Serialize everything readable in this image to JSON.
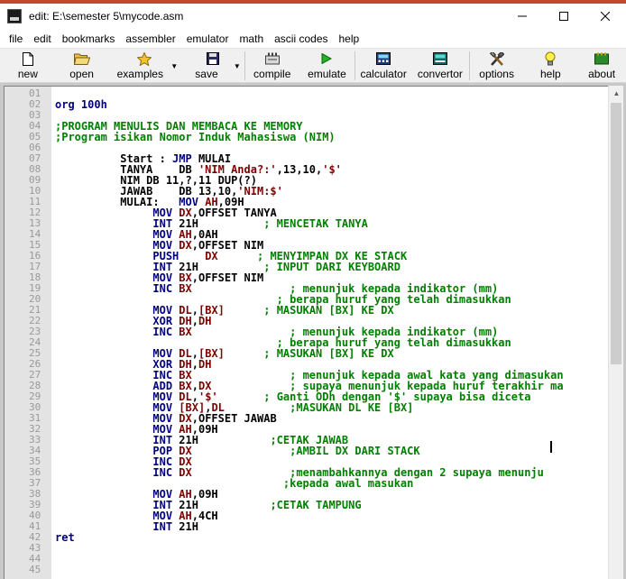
{
  "window": {
    "title": "edit: E:\\semester 5\\mycode.asm",
    "controls": [
      "minimize-icon",
      "maximize-icon",
      "close-icon"
    ]
  },
  "menu": [
    "file",
    "edit",
    "bookmarks",
    "assembler",
    "emulator",
    "math",
    "ascii codes",
    "help"
  ],
  "toolbar": [
    {
      "name": "new",
      "label": "new",
      "icon": "document-icon"
    },
    {
      "name": "open",
      "label": "open",
      "icon": "folder-icon"
    },
    {
      "name": "examples",
      "label": "examples",
      "icon": "star-icon"
    },
    {
      "name": "save",
      "label": "save",
      "icon": "floppy-icon"
    },
    {
      "name": "compile",
      "label": "compile",
      "icon": "compile-icon"
    },
    {
      "name": "emulate",
      "label": "emulate",
      "icon": "play-icon"
    },
    {
      "name": "calculator",
      "label": "calculator",
      "icon": "calculator-icon"
    },
    {
      "name": "convertor",
      "label": "convertor",
      "icon": "convertor-icon"
    },
    {
      "name": "options",
      "label": "options",
      "icon": "tools-icon"
    },
    {
      "name": "help",
      "label": "help",
      "icon": "lightbulb-icon"
    },
    {
      "name": "about",
      "label": "about",
      "icon": "about-icon"
    }
  ],
  "colors": {
    "directive": "#000080",
    "comment": "#008000",
    "register": "#800000",
    "gutter": "#e3e3e3"
  },
  "code": {
    "line_numbers": [
      "01",
      "02",
      "03",
      "04",
      "05",
      "06",
      "07",
      "08",
      "09",
      "10",
      "11",
      "12",
      "13",
      "14",
      "15",
      "16",
      "17",
      "18",
      "19",
      "20",
      "21",
      "22",
      "23",
      "24",
      "25",
      "26",
      "27",
      "28",
      "29",
      "30",
      "31",
      "32",
      "33",
      "34",
      "35",
      "36",
      "37",
      "38",
      "39",
      "40",
      "41",
      "42",
      "43",
      "44",
      "45"
    ],
    "lines": [
      [],
      [
        {
          "t": "org 100h",
          "c": "c-dir"
        }
      ],
      [],
      [
        {
          "t": ";PROGRAM MENULIS DAN MEMBACA KE MEMORY",
          "c": "c-cmt"
        }
      ],
      [
        {
          "t": ";Program isikan Nomor Induk Mahasiswa (NIM)",
          "c": "c-cmt"
        }
      ],
      [],
      [
        {
          "t": "          Start : ",
          "c": "c-txt"
        },
        {
          "t": "JMP",
          "c": "c-kw"
        },
        {
          "t": " MULAI",
          "c": "c-txt"
        }
      ],
      [
        {
          "t": "          TANYA    DB ",
          "c": "c-txt"
        },
        {
          "t": "'NIM Anda?:'",
          "c": "c-str"
        },
        {
          "t": ",13,10,",
          "c": "c-txt"
        },
        {
          "t": "'$'",
          "c": "c-str"
        }
      ],
      [
        {
          "t": "          NIM DB 11,?,11 DUP(?)",
          "c": "c-txt"
        }
      ],
      [
        {
          "t": "          JAWAB    DB 13,10,",
          "c": "c-txt"
        },
        {
          "t": "'NIM:$'",
          "c": "c-str"
        }
      ],
      [
        {
          "t": "          MULAI:   ",
          "c": "c-txt"
        },
        {
          "t": "MOV",
          "c": "c-kw"
        },
        {
          "t": " ",
          "c": "c-txt"
        },
        {
          "t": "AH",
          "c": "c-reg"
        },
        {
          "t": ",09H",
          "c": "c-txt"
        }
      ],
      [
        {
          "t": "               ",
          "c": "c-txt"
        },
        {
          "t": "MOV",
          "c": "c-kw"
        },
        {
          "t": " ",
          "c": "c-txt"
        },
        {
          "t": "DX",
          "c": "c-reg"
        },
        {
          "t": ",OFFSET TANYA",
          "c": "c-txt"
        }
      ],
      [
        {
          "t": "               ",
          "c": "c-txt"
        },
        {
          "t": "INT",
          "c": "c-kw"
        },
        {
          "t": " 21H          ",
          "c": "c-txt"
        },
        {
          "t": "; MENCETAK TANYA",
          "c": "c-cmt"
        }
      ],
      [
        {
          "t": "               ",
          "c": "c-txt"
        },
        {
          "t": "MOV",
          "c": "c-kw"
        },
        {
          "t": " ",
          "c": "c-txt"
        },
        {
          "t": "AH",
          "c": "c-reg"
        },
        {
          "t": ",0AH",
          "c": "c-txt"
        }
      ],
      [
        {
          "t": "               ",
          "c": "c-txt"
        },
        {
          "t": "MOV",
          "c": "c-kw"
        },
        {
          "t": " ",
          "c": "c-txt"
        },
        {
          "t": "DX",
          "c": "c-reg"
        },
        {
          "t": ",OFFSET NIM",
          "c": "c-txt"
        }
      ],
      [
        {
          "t": "               ",
          "c": "c-txt"
        },
        {
          "t": "PUSH",
          "c": "c-kw"
        },
        {
          "t": "    ",
          "c": "c-txt"
        },
        {
          "t": "DX",
          "c": "c-reg"
        },
        {
          "t": "      ",
          "c": "c-txt"
        },
        {
          "t": "; MENYIMPAN DX KE STACK",
          "c": "c-cmt"
        }
      ],
      [
        {
          "t": "               ",
          "c": "c-txt"
        },
        {
          "t": "INT",
          "c": "c-kw"
        },
        {
          "t": " 21H          ",
          "c": "c-txt"
        },
        {
          "t": "; INPUT DARI KEYBOARD",
          "c": "c-cmt"
        }
      ],
      [
        {
          "t": "               ",
          "c": "c-txt"
        },
        {
          "t": "MOV",
          "c": "c-kw"
        },
        {
          "t": " ",
          "c": "c-txt"
        },
        {
          "t": "BX",
          "c": "c-reg"
        },
        {
          "t": ",OFFSET NIM",
          "c": "c-txt"
        }
      ],
      [
        {
          "t": "               ",
          "c": "c-txt"
        },
        {
          "t": "INC",
          "c": "c-kw"
        },
        {
          "t": " ",
          "c": "c-txt"
        },
        {
          "t": "BX",
          "c": "c-reg"
        },
        {
          "t": "               ",
          "c": "c-txt"
        },
        {
          "t": "; menunjuk kepada indikator (mm)",
          "c": "c-cmt"
        }
      ],
      [
        {
          "t": "                                  ",
          "c": "c-txt"
        },
        {
          "t": "; berapa huruf yang telah dimasukkan",
          "c": "c-cmt"
        }
      ],
      [
        {
          "t": "               ",
          "c": "c-txt"
        },
        {
          "t": "MOV",
          "c": "c-kw"
        },
        {
          "t": " ",
          "c": "c-txt"
        },
        {
          "t": "DL",
          "c": "c-reg"
        },
        {
          "t": ",",
          "c": "c-txt"
        },
        {
          "t": "[BX]",
          "c": "c-reg"
        },
        {
          "t": "      ",
          "c": "c-txt"
        },
        {
          "t": "; MASUKAN [BX] KE DX",
          "c": "c-cmt"
        }
      ],
      [
        {
          "t": "               ",
          "c": "c-txt"
        },
        {
          "t": "XOR",
          "c": "c-kw"
        },
        {
          "t": " ",
          "c": "c-txt"
        },
        {
          "t": "DH",
          "c": "c-reg"
        },
        {
          "t": ",",
          "c": "c-txt"
        },
        {
          "t": "DH",
          "c": "c-reg"
        }
      ],
      [
        {
          "t": "               ",
          "c": "c-txt"
        },
        {
          "t": "INC",
          "c": "c-kw"
        },
        {
          "t": " ",
          "c": "c-txt"
        },
        {
          "t": "BX",
          "c": "c-reg"
        },
        {
          "t": "               ",
          "c": "c-txt"
        },
        {
          "t": "; menunjuk kepada indikator (mm)",
          "c": "c-cmt"
        }
      ],
      [
        {
          "t": "                                  ",
          "c": "c-txt"
        },
        {
          "t": "; berapa huruf yang telah dimasukkan",
          "c": "c-cmt"
        }
      ],
      [
        {
          "t": "               ",
          "c": "c-txt"
        },
        {
          "t": "MOV",
          "c": "c-kw"
        },
        {
          "t": " ",
          "c": "c-txt"
        },
        {
          "t": "DL",
          "c": "c-reg"
        },
        {
          "t": ",",
          "c": "c-txt"
        },
        {
          "t": "[BX]",
          "c": "c-reg"
        },
        {
          "t": "      ",
          "c": "c-txt"
        },
        {
          "t": "; MASUKAN [BX] KE DX",
          "c": "c-cmt"
        }
      ],
      [
        {
          "t": "               ",
          "c": "c-txt"
        },
        {
          "t": "XOR",
          "c": "c-kw"
        },
        {
          "t": " ",
          "c": "c-txt"
        },
        {
          "t": "DH",
          "c": "c-reg"
        },
        {
          "t": ",",
          "c": "c-txt"
        },
        {
          "t": "DH",
          "c": "c-reg"
        }
      ],
      [
        {
          "t": "               ",
          "c": "c-txt"
        },
        {
          "t": "INC",
          "c": "c-kw"
        },
        {
          "t": " ",
          "c": "c-txt"
        },
        {
          "t": "BX",
          "c": "c-reg"
        },
        {
          "t": "               ",
          "c": "c-txt"
        },
        {
          "t": "; menunjuk kepada awal kata yang dimasukan",
          "c": "c-cmt"
        }
      ],
      [
        {
          "t": "               ",
          "c": "c-txt"
        },
        {
          "t": "ADD",
          "c": "c-kw"
        },
        {
          "t": " ",
          "c": "c-txt"
        },
        {
          "t": "BX",
          "c": "c-reg"
        },
        {
          "t": ",",
          "c": "c-txt"
        },
        {
          "t": "DX",
          "c": "c-reg"
        },
        {
          "t": "            ",
          "c": "c-txt"
        },
        {
          "t": "; supaya menunjuk kepada huruf terakhir ma",
          "c": "c-cmt"
        }
      ],
      [
        {
          "t": "               ",
          "c": "c-txt"
        },
        {
          "t": "MOV",
          "c": "c-kw"
        },
        {
          "t": " ",
          "c": "c-txt"
        },
        {
          "t": "DL",
          "c": "c-reg"
        },
        {
          "t": ",",
          "c": "c-txt"
        },
        {
          "t": "'$'",
          "c": "c-str"
        },
        {
          "t": "       ",
          "c": "c-txt"
        },
        {
          "t": "; Ganti ODh dengan '$' supaya bisa diceta",
          "c": "c-cmt"
        }
      ],
      [
        {
          "t": "               ",
          "c": "c-txt"
        },
        {
          "t": "MOV",
          "c": "c-kw"
        },
        {
          "t": " ",
          "c": "c-txt"
        },
        {
          "t": "[BX]",
          "c": "c-reg"
        },
        {
          "t": ",",
          "c": "c-txt"
        },
        {
          "t": "DL",
          "c": "c-reg"
        },
        {
          "t": "          ",
          "c": "c-txt"
        },
        {
          "t": ";MASUKAN DL KE [BX]",
          "c": "c-cmt"
        }
      ],
      [
        {
          "t": "               ",
          "c": "c-txt"
        },
        {
          "t": "MOV",
          "c": "c-kw"
        },
        {
          "t": " ",
          "c": "c-txt"
        },
        {
          "t": "DX",
          "c": "c-reg"
        },
        {
          "t": ",OFFSET JAWAB",
          "c": "c-txt"
        }
      ],
      [
        {
          "t": "               ",
          "c": "c-txt"
        },
        {
          "t": "MOV",
          "c": "c-kw"
        },
        {
          "t": " ",
          "c": "c-txt"
        },
        {
          "t": "AH",
          "c": "c-reg"
        },
        {
          "t": ",09H",
          "c": "c-txt"
        }
      ],
      [
        {
          "t": "               ",
          "c": "c-txt"
        },
        {
          "t": "INT",
          "c": "c-kw"
        },
        {
          "t": " 21H           ",
          "c": "c-txt"
        },
        {
          "t": ";CETAK JAWAB",
          "c": "c-cmt"
        }
      ],
      [
        {
          "t": "               ",
          "c": "c-txt"
        },
        {
          "t": "POP",
          "c": "c-kw"
        },
        {
          "t": " ",
          "c": "c-txt"
        },
        {
          "t": "DX",
          "c": "c-reg"
        },
        {
          "t": "               ",
          "c": "c-txt"
        },
        {
          "t": ";AMBIL DX DARI STACK",
          "c": "c-cmt"
        }
      ],
      [
        {
          "t": "               ",
          "c": "c-txt"
        },
        {
          "t": "INC",
          "c": "c-kw"
        },
        {
          "t": " ",
          "c": "c-txt"
        },
        {
          "t": "DX",
          "c": "c-reg"
        }
      ],
      [
        {
          "t": "               ",
          "c": "c-txt"
        },
        {
          "t": "INC",
          "c": "c-kw"
        },
        {
          "t": " ",
          "c": "c-txt"
        },
        {
          "t": "DX",
          "c": "c-reg"
        },
        {
          "t": "               ",
          "c": "c-txt"
        },
        {
          "t": ";menambahkannya dengan 2 supaya menunju",
          "c": "c-cmt"
        }
      ],
      [
        {
          "t": "                                   ",
          "c": "c-txt"
        },
        {
          "t": ";kepada awal masukan",
          "c": "c-cmt"
        }
      ],
      [
        {
          "t": "               ",
          "c": "c-txt"
        },
        {
          "t": "MOV",
          "c": "c-kw"
        },
        {
          "t": " ",
          "c": "c-txt"
        },
        {
          "t": "AH",
          "c": "c-reg"
        },
        {
          "t": ",09H",
          "c": "c-txt"
        }
      ],
      [
        {
          "t": "               ",
          "c": "c-txt"
        },
        {
          "t": "INT",
          "c": "c-kw"
        },
        {
          "t": " 21H           ",
          "c": "c-txt"
        },
        {
          "t": ";CETAK TAMPUNG",
          "c": "c-cmt"
        }
      ],
      [
        {
          "t": "               ",
          "c": "c-txt"
        },
        {
          "t": "MOV",
          "c": "c-kw"
        },
        {
          "t": " ",
          "c": "c-txt"
        },
        {
          "t": "AH",
          "c": "c-reg"
        },
        {
          "t": ",4CH",
          "c": "c-txt"
        }
      ],
      [
        {
          "t": "               ",
          "c": "c-txt"
        },
        {
          "t": "INT",
          "c": "c-kw"
        },
        {
          "t": " 21H",
          "c": "c-txt"
        }
      ],
      [
        {
          "t": "ret",
          "c": "c-dir"
        }
      ],
      [],
      [],
      []
    ]
  }
}
